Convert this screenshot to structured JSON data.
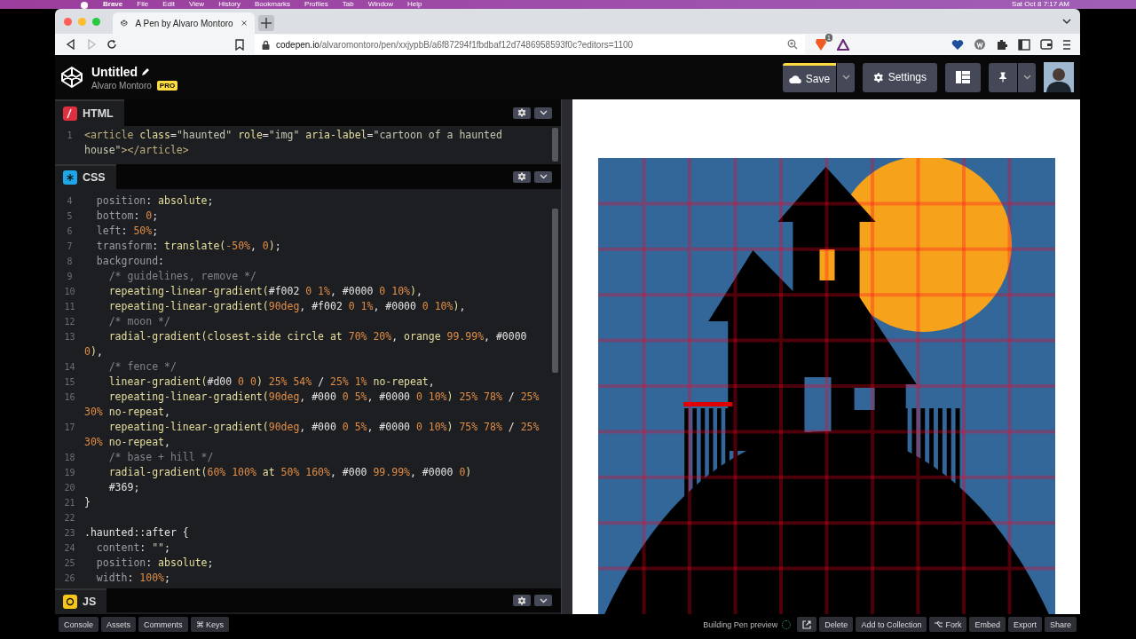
{
  "menubar": {
    "app": "Brave",
    "items": [
      "File",
      "Edit",
      "View",
      "History",
      "Bookmarks",
      "Profiles",
      "Tab",
      "Window",
      "Help"
    ],
    "clock": "Sat Oct 8  7:17 AM"
  },
  "browser": {
    "tab": {
      "title": "A Pen by Alvaro Montoro",
      "selected": true
    },
    "url_host": "codepen.io",
    "url_path": "/alvaromontoro/pen/xxjypbB/a6f87294f1fbdbaf12d7486958593f0c?editors=1100",
    "shield_count": "1"
  },
  "pen": {
    "title": "Untitled",
    "author": "Alvaro Montoro",
    "badge": "PRO",
    "save": "Save",
    "settings": "Settings"
  },
  "editors": [
    {
      "kind": "html",
      "label": "HTML",
      "lines": [
        {
          "n": "1",
          "tokens": [
            {
              "kind": "tag",
              "text": "<article "
            },
            {
              "kind": "attr",
              "text": "class"
            },
            {
              "kind": "p",
              "text": "="
            },
            {
              "kind": "str",
              "text": "\"haunted\" "
            },
            {
              "kind": "attr",
              "text": "role"
            },
            {
              "kind": "p",
              "text": "="
            },
            {
              "kind": "str",
              "text": "\"img\" "
            },
            {
              "kind": "attr",
              "text": "aria-label"
            },
            {
              "kind": "p",
              "text": "="
            },
            {
              "kind": "str",
              "text": "\"cartoon of a haunted"
            }
          ]
        },
        {
          "tokens": [
            {
              "kind": "str",
              "text": "house\""
            },
            {
              "kind": "tag",
              "text": "></article>"
            }
          ]
        }
      ]
    },
    {
      "kind": "css",
      "label": "CSS",
      "lines": [
        {
          "n": "4",
          "tokens": [
            {
              "kind": "prop",
              "text": "  position"
            },
            {
              "kind": "p",
              "text": ": "
            },
            {
              "kind": "val",
              "text": "absolute"
            },
            {
              "kind": "p",
              "text": ";"
            }
          ]
        },
        {
          "n": "5",
          "tokens": [
            {
              "kind": "prop",
              "text": "  bottom"
            },
            {
              "kind": "p",
              "text": ": "
            },
            {
              "kind": "num",
              "text": "0"
            },
            {
              "kind": "p",
              "text": ";"
            }
          ]
        },
        {
          "n": "6",
          "tokens": [
            {
              "kind": "prop",
              "text": "  left"
            },
            {
              "kind": "p",
              "text": ": "
            },
            {
              "kind": "num",
              "text": "50%"
            },
            {
              "kind": "p",
              "text": ";"
            }
          ]
        },
        {
          "n": "7",
          "tokens": [
            {
              "kind": "prop",
              "text": "  transform"
            },
            {
              "kind": "p",
              "text": ": "
            },
            {
              "kind": "val",
              "text": "translate("
            },
            {
              "kind": "num",
              "text": "-50%"
            },
            {
              "kind": "p",
              "text": ", "
            },
            {
              "kind": "num",
              "text": "0"
            },
            {
              "kind": "val",
              "text": ")"
            },
            {
              "kind": "p",
              "text": ";"
            }
          ]
        },
        {
          "n": "8",
          "tokens": [
            {
              "kind": "prop",
              "text": "  background"
            },
            {
              "kind": "p",
              "text": ":"
            }
          ]
        },
        {
          "n": "9",
          "tokens": [
            {
              "kind": "com",
              "text": "    /* guidelines, remove */"
            }
          ]
        },
        {
          "n": "10",
          "tokens": [
            {
              "kind": "val",
              "text": "    repeating-linear-gradient("
            },
            {
              "kind": "p",
              "text": "#f002 "
            },
            {
              "kind": "num",
              "text": "0 1%"
            },
            {
              "kind": "p",
              "text": ", #0000 "
            },
            {
              "kind": "num",
              "text": "0 10%"
            },
            {
              "kind": "val",
              "text": ")"
            },
            {
              "kind": "p",
              "text": ","
            }
          ]
        },
        {
          "n": "11",
          "tokens": [
            {
              "kind": "val",
              "text": "    repeating-linear-gradient("
            },
            {
              "kind": "num",
              "text": "90deg"
            },
            {
              "kind": "p",
              "text": ", #f002 "
            },
            {
              "kind": "num",
              "text": "0 1%"
            },
            {
              "kind": "p",
              "text": ", #0000 "
            },
            {
              "kind": "num",
              "text": "0 10%"
            },
            {
              "kind": "val",
              "text": ")"
            },
            {
              "kind": "p",
              "text": ","
            }
          ]
        },
        {
          "n": "12",
          "tokens": [
            {
              "kind": "com",
              "text": "    /* moon */"
            }
          ]
        },
        {
          "n": "13",
          "tokens": [
            {
              "kind": "val",
              "text": "    radial-gradient(closest-side circle at "
            },
            {
              "kind": "num",
              "text": "70% 20%"
            },
            {
              "kind": "p",
              "text": ", "
            },
            {
              "kind": "val",
              "text": "orange "
            },
            {
              "kind": "num",
              "text": "99.99%"
            },
            {
              "kind": "p",
              "text": ", #0000"
            }
          ]
        },
        {
          "tokens": [
            {
              "kind": "num",
              "text": "0"
            },
            {
              "kind": "val",
              "text": ")"
            },
            {
              "kind": "p",
              "text": ","
            }
          ]
        },
        {
          "n": "14",
          "tokens": [
            {
              "kind": "com",
              "text": "    /* fence */"
            }
          ]
        },
        {
          "n": "15",
          "tokens": [
            {
              "kind": "val",
              "text": "    linear-gradient("
            },
            {
              "kind": "p",
              "text": "#d00 "
            },
            {
              "kind": "num",
              "text": "0 0"
            },
            {
              "kind": "val",
              "text": ") "
            },
            {
              "kind": "num",
              "text": "25% 54%"
            },
            {
              "kind": "p",
              "text": " / "
            },
            {
              "kind": "num",
              "text": "25% 1%"
            },
            {
              "kind": "val",
              "text": " no-repeat"
            },
            {
              "kind": "p",
              "text": ","
            }
          ]
        },
        {
          "n": "16",
          "tokens": [
            {
              "kind": "val",
              "text": "    repeating-linear-gradient("
            },
            {
              "kind": "num",
              "text": "90deg"
            },
            {
              "kind": "p",
              "text": ", #000 "
            },
            {
              "kind": "num",
              "text": "0 5%"
            },
            {
              "kind": "p",
              "text": ", #0000 "
            },
            {
              "kind": "num",
              "text": "0 10%"
            },
            {
              "kind": "val",
              "text": ") "
            },
            {
              "kind": "num",
              "text": "25% 78%"
            },
            {
              "kind": "p",
              "text": " / "
            },
            {
              "kind": "num",
              "text": "25%"
            }
          ]
        },
        {
          "tokens": [
            {
              "kind": "num",
              "text": "30%"
            },
            {
              "kind": "val",
              "text": " no-repeat"
            },
            {
              "kind": "p",
              "text": ","
            }
          ]
        },
        {
          "n": "17",
          "tokens": [
            {
              "kind": "val",
              "text": "    repeating-linear-gradient("
            },
            {
              "kind": "num",
              "text": "90deg"
            },
            {
              "kind": "p",
              "text": ", #000 "
            },
            {
              "kind": "num",
              "text": "0 5%"
            },
            {
              "kind": "p",
              "text": ", #0000 "
            },
            {
              "kind": "num",
              "text": "0 10%"
            },
            {
              "kind": "val",
              "text": ") "
            },
            {
              "kind": "num",
              "text": "75% 78%"
            },
            {
              "kind": "p",
              "text": " / "
            },
            {
              "kind": "num",
              "text": "25%"
            }
          ]
        },
        {
          "tokens": [
            {
              "kind": "num",
              "text": "30%"
            },
            {
              "kind": "val",
              "text": " no-repeat"
            },
            {
              "kind": "p",
              "text": ","
            }
          ]
        },
        {
          "n": "18",
          "tokens": [
            {
              "kind": "com",
              "text": "    /* base + hill */"
            }
          ]
        },
        {
          "n": "19",
          "tokens": [
            {
              "kind": "val",
              "text": "    radial-gradient("
            },
            {
              "kind": "num",
              "text": "60% 100%"
            },
            {
              "kind": "val",
              "text": " at "
            },
            {
              "kind": "num",
              "text": "50% 160%"
            },
            {
              "kind": "p",
              "text": ", #000 "
            },
            {
              "kind": "num",
              "text": "99.99%"
            },
            {
              "kind": "p",
              "text": ", #0000 "
            },
            {
              "kind": "num",
              "text": "0"
            },
            {
              "kind": "val",
              "text": ")"
            }
          ]
        },
        {
          "n": "20",
          "tokens": [
            {
              "kind": "p",
              "text": "    #369;"
            }
          ]
        },
        {
          "n": "21",
          "tokens": [
            {
              "kind": "p",
              "text": "}"
            }
          ]
        },
        {
          "n": "22"
        },
        {
          "n": "23",
          "tokens": [
            {
              "kind": "sel",
              "text": ".haunted::after {"
            }
          ]
        },
        {
          "n": "24",
          "tokens": [
            {
              "kind": "prop",
              "text": "  content"
            },
            {
              "kind": "p",
              "text": ": "
            },
            {
              "kind": "str",
              "text": "\"\""
            },
            {
              "kind": "p",
              "text": ";"
            }
          ]
        },
        {
          "n": "25",
          "tokens": [
            {
              "kind": "prop",
              "text": "  position"
            },
            {
              "kind": "p",
              "text": ": "
            },
            {
              "kind": "val",
              "text": "absolute"
            },
            {
              "kind": "p",
              "text": ";"
            }
          ]
        },
        {
          "n": "26",
          "tokens": [
            {
              "kind": "prop",
              "text": "  width"
            },
            {
              "kind": "p",
              "text": ": "
            },
            {
              "kind": "num",
              "text": "100%"
            },
            {
              "kind": "p",
              "text": ";"
            }
          ]
        }
      ]
    },
    {
      "kind": "js",
      "label": "JS"
    }
  ],
  "preview": {
    "kind": "haunted-house"
  },
  "footer": {
    "left": [
      "Console",
      "Assets",
      "Comments",
      "⌘ Keys"
    ],
    "status": "Building Pen preview",
    "right": [
      "Delete",
      "Add to Collection",
      "Fork",
      "Embed",
      "Export",
      "Share"
    ]
  }
}
